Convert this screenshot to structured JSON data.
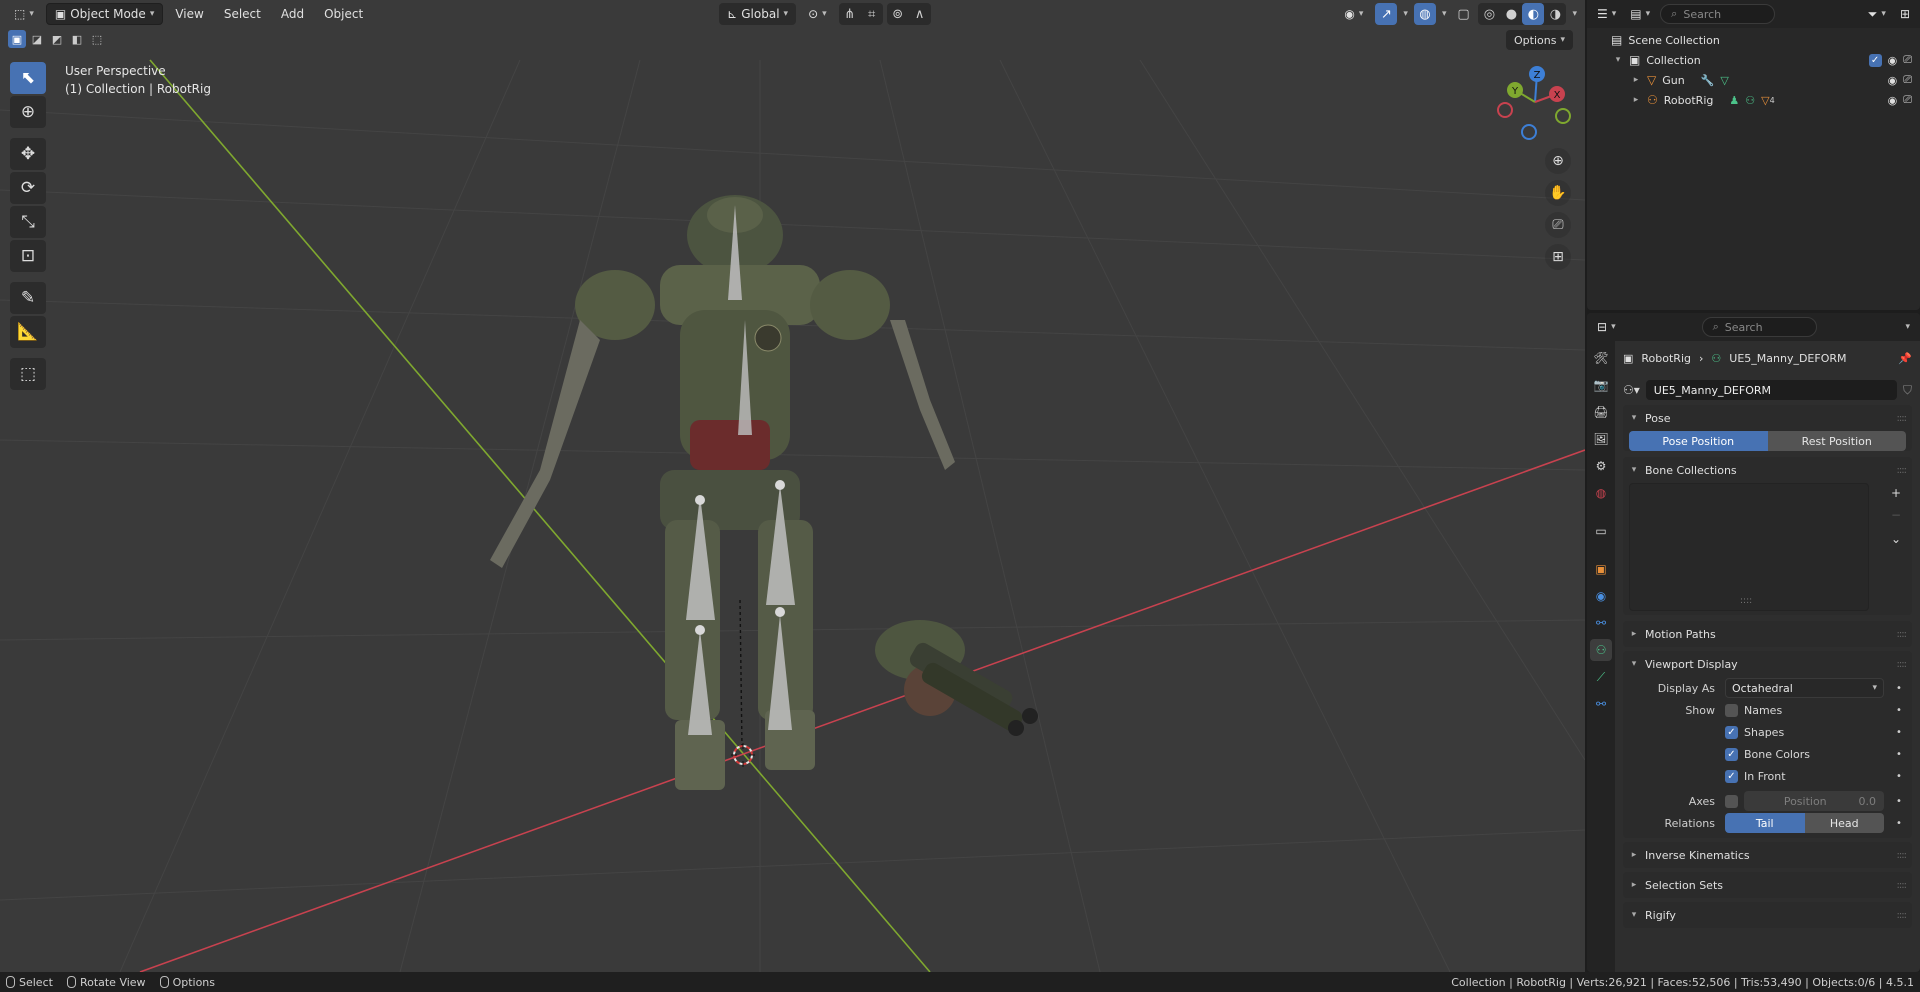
{
  "viewport": {
    "header": {
      "editor_icon": "view3d-icon",
      "mode": "Object Mode",
      "menus": [
        "View",
        "Select",
        "Add",
        "Object"
      ],
      "transform_orientation": "Global"
    },
    "overlay_line1": "User Perspective",
    "overlay_line2": "(1) Collection | RobotRig",
    "options_label": "Options",
    "gizmo": {
      "x": "X",
      "y": "Y",
      "z": "Z"
    },
    "tools": [
      "select-box",
      "cursor",
      "move",
      "rotate",
      "scale",
      "transform",
      "annotate",
      "measure",
      "add-cube"
    ]
  },
  "outliner": {
    "search_placeholder": "Search",
    "scene_collection": "Scene Collection",
    "collection": "Collection",
    "items": [
      {
        "label": "Gun"
      },
      {
        "label": "RobotRig",
        "badge_count": "4"
      }
    ]
  },
  "properties": {
    "search_placeholder": "Search",
    "breadcrumb_object": "RobotRig",
    "breadcrumb_data": "UE5_Manny_DEFORM",
    "data_name": "UE5_Manny_DEFORM",
    "sections": {
      "pose": "Pose",
      "pose_position": "Pose Position",
      "rest_position": "Rest Position",
      "bone_collections": "Bone Collections",
      "motion_paths": "Motion Paths",
      "viewport_display": "Viewport Display",
      "inverse_kinematics": "Inverse Kinematics",
      "selection_sets": "Selection Sets",
      "rigify": "Rigify"
    },
    "viewport_display": {
      "display_as_label": "Display As",
      "display_as_value": "Octahedral",
      "show_label": "Show",
      "names": "Names",
      "shapes": "Shapes",
      "bone_colors": "Bone Colors",
      "in_front": "In Front",
      "axes_label": "Axes",
      "axes_position_label": "Position",
      "axes_position_value": "0.0",
      "relations_label": "Relations",
      "tail": "Tail",
      "head": "Head"
    }
  },
  "statusbar": {
    "select": "Select",
    "rotate_view": "Rotate View",
    "options": "Options",
    "stats": "Collection | RobotRig | Verts:26,921 | Faces:52,506 | Tris:53,490 | Objects:0/6 | 4.5.1"
  },
  "colors": {
    "accent": "#4772b3",
    "x_axis": "#c8424f",
    "y_axis": "#7fa82f",
    "z_axis": "#3d7fd6",
    "viewport_bg": "#3a3a3a"
  }
}
